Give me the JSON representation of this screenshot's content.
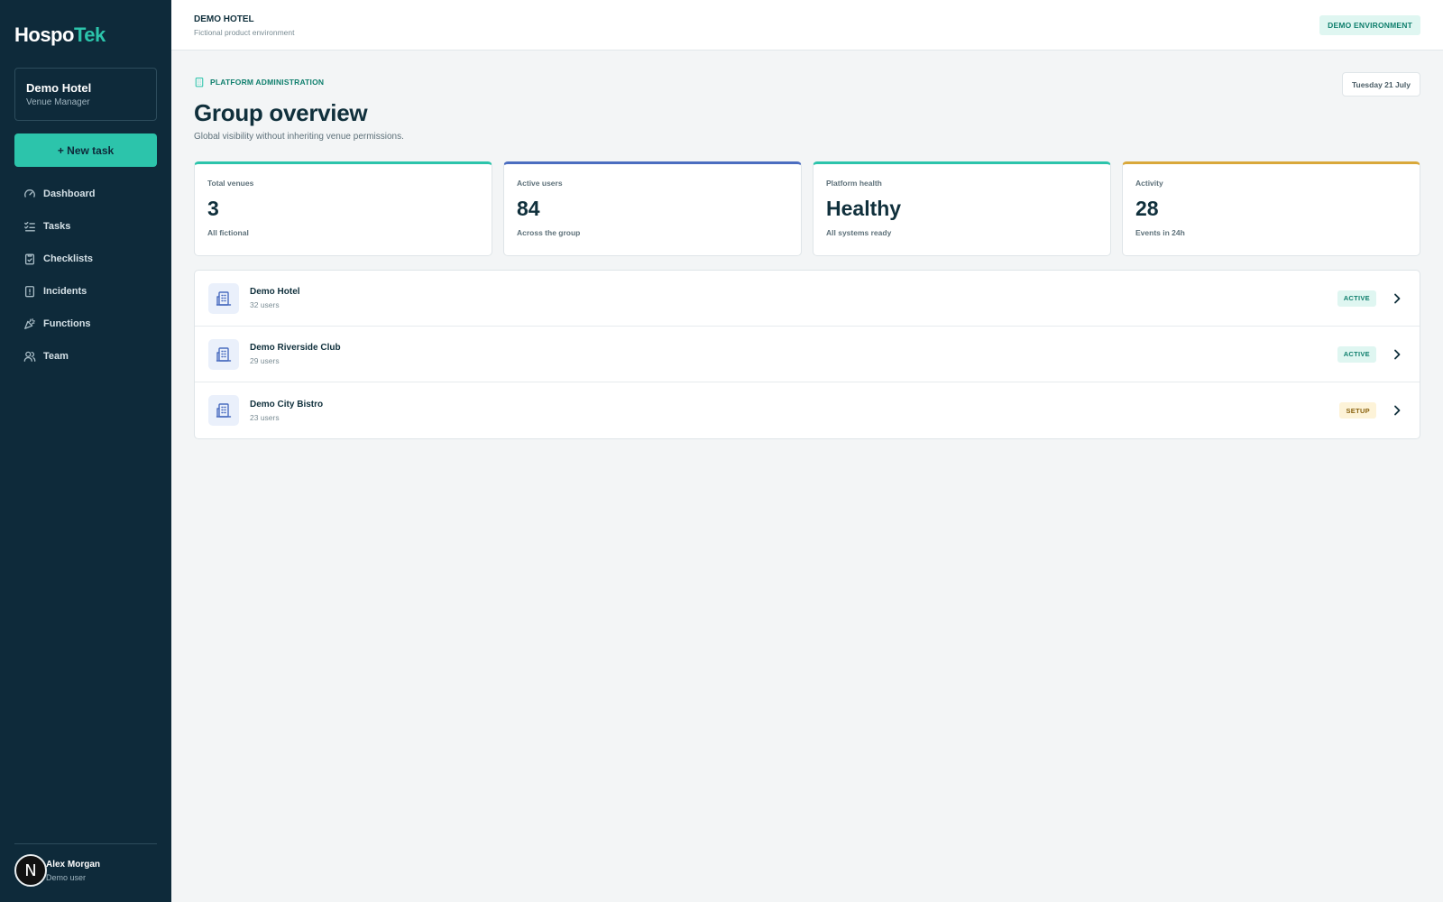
{
  "brand": {
    "name_part1": "Hospo",
    "name_part2": "Tek",
    "accent_color": "#2cc4ab",
    "sidebar_bg": "#0e2a3a"
  },
  "sidebar": {
    "venue": {
      "name": "Demo Hotel",
      "role": "Venue Manager"
    },
    "new_task_label": "+ New task",
    "items": [
      {
        "label": "Dashboard",
        "icon": "gauge-icon"
      },
      {
        "label": "Tasks",
        "icon": "task-list-icon"
      },
      {
        "label": "Checklists",
        "icon": "clipboard-check-icon"
      },
      {
        "label": "Incidents",
        "icon": "alert-file-icon"
      },
      {
        "label": "Functions",
        "icon": "party-popper-icon"
      },
      {
        "label": "Team",
        "icon": "users-icon"
      }
    ],
    "user": {
      "avatar_initial": "N",
      "name": "Alex Morgan",
      "subtitle": "Demo user"
    }
  },
  "topbar": {
    "title": "DEMO HOTEL",
    "subtitle": "Fictional product environment",
    "env_badge": "DEMO ENVIRONMENT"
  },
  "header": {
    "eyebrow": "PLATFORM ADMINISTRATION",
    "title": "Group overview",
    "subtitle": "Global visibility without inheriting venue permissions.",
    "date": "Tuesday 21 July"
  },
  "stats": [
    {
      "label": "Total venues",
      "value": "3",
      "note": "All fictional",
      "color": "#2cc4ab"
    },
    {
      "label": "Active users",
      "value": "84",
      "note": "Across the group",
      "color": "#4b6dc0"
    },
    {
      "label": "Platform health",
      "value": "Healthy",
      "note": "All systems ready",
      "color": "#2cc4ab"
    },
    {
      "label": "Activity",
      "value": "28",
      "note": "Events in 24h",
      "color": "#d9a83a"
    }
  ],
  "venues": [
    {
      "name": "Demo Hotel",
      "users": "32 users",
      "status": "ACTIVE"
    },
    {
      "name": "Demo Riverside Club",
      "users": "29 users",
      "status": "ACTIVE"
    },
    {
      "name": "Demo City Bistro",
      "users": "23 users",
      "status": "SETUP"
    }
  ]
}
